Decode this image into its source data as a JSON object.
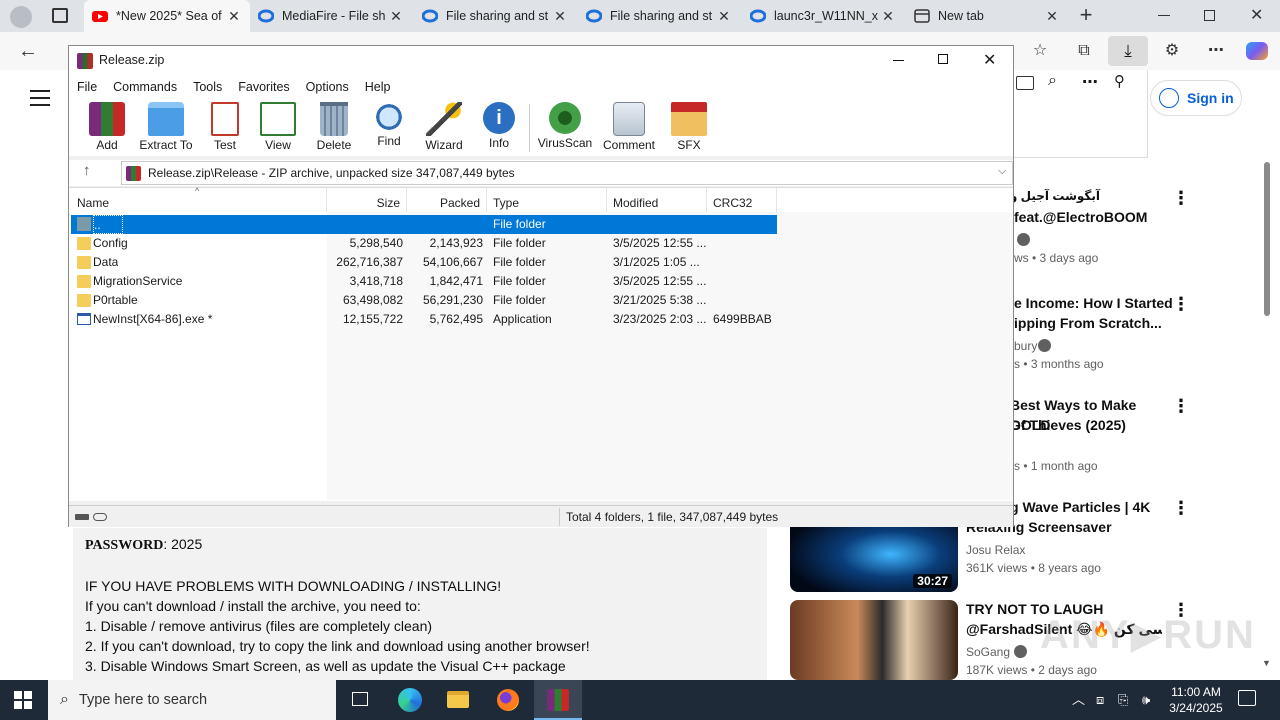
{
  "browser": {
    "tabs": [
      {
        "title": "*New 2025* Sea of",
        "icon": "youtube-icon",
        "active": true
      },
      {
        "title": "MediaFire - File sh",
        "icon": "edge-icon"
      },
      {
        "title": "File sharing and st",
        "icon": "edge-icon"
      },
      {
        "title": "File sharing and st",
        "icon": "edge-icon"
      },
      {
        "title": "launc3r_W11NN_x",
        "icon": "edge-icon"
      },
      {
        "title": "New tab",
        "icon": "newtab-icon"
      }
    ],
    "sign_in": "Sign in"
  },
  "page": {
    "description": {
      "password_label": "PASSWORD",
      "password_value": ": 2025",
      "lines": [
        "IF YOU HAVE PROBLEMS WITH DOWNLOADING / INSTALLING!",
        "If you can't download / install the archive, you need to:",
        "1. Disable / remove antivirus (files are completely clean)",
        "2. If you can't download, try to copy the link and download using another browser!",
        "3. Disable Windows Smart Screen, as well as update the Visual C++ package"
      ]
    },
    "related": [
      {
        "title1": "آبگوشت آجیل و دسر",
        "title2": "feat.@ElectroBOOM",
        "channel": "",
        "meta": "ws • 3 days ago",
        "duration": ""
      },
      {
        "title1": "e Income: How I Started",
        "title2": "ipping From Scratch...",
        "channel": "bury",
        "meta": "s • 3 months ago",
        "duration": ""
      },
      {
        "title1": "Best Ways to Make GOLD",
        "title2": "Of Thieves (2025)",
        "channel": "",
        "meta": "s • 1 month ago",
        "duration": ""
      },
      {
        "title1": "g Wave Particles | 4K",
        "title2": "Relaxing Screensaver",
        "channel": "Josu Relax",
        "meta": "361K views • 8 years ago",
        "duration": "30:27"
      },
      {
        "title1": "TRY NOT TO LAUGH",
        "title2": "@FarshadSilent 😂🔥 سی کن...",
        "channel": "SoGang",
        "meta": "187K views • 2 days ago",
        "duration": ""
      }
    ]
  },
  "winrar": {
    "title": "Release.zip",
    "menu": [
      "File",
      "Commands",
      "Tools",
      "Favorites",
      "Options",
      "Help"
    ],
    "toolbar": [
      "Add",
      "Extract To",
      "Test",
      "View",
      "Delete",
      "Find",
      "Wizard",
      "Info",
      "VirusScan",
      "Comment",
      "SFX"
    ],
    "path": "Release.zip\\Release - ZIP archive, unpacked size 347,087,449 bytes",
    "columns": [
      "Name",
      "Size",
      "Packed",
      "Type",
      "Modified",
      "CRC32"
    ],
    "rows": [
      {
        "name": "..",
        "size": "",
        "packed": "",
        "type": "File folder",
        "modified": "",
        "crc": "",
        "icon": "folder-up-icon"
      },
      {
        "name": "Config",
        "size": "5,298,540",
        "packed": "2,143,923",
        "type": "File folder",
        "modified": "3/5/2025 12:55 ...",
        "crc": "",
        "icon": "folder-icon"
      },
      {
        "name": "Data",
        "size": "262,716,387",
        "packed": "54,106,667",
        "type": "File folder",
        "modified": "3/1/2025 1:05 ...",
        "crc": "",
        "icon": "folder-icon"
      },
      {
        "name": "MigrationService",
        "size": "3,418,718",
        "packed": "1,842,471",
        "type": "File folder",
        "modified": "3/5/2025 12:55 ...",
        "crc": "",
        "icon": "folder-icon"
      },
      {
        "name": "P0rtable",
        "size": "63,498,082",
        "packed": "56,291,230",
        "type": "File folder",
        "modified": "3/21/2025 5:38 ...",
        "crc": "",
        "icon": "folder-icon"
      },
      {
        "name": "NewInst[X64-86].exe *",
        "size": "12,155,722",
        "packed": "5,762,495",
        "type": "Application",
        "modified": "3/23/2025 2:03 ...",
        "crc": "6499BBAB",
        "icon": "exe-icon"
      }
    ],
    "status": "Total 4 folders, 1 file, 347,087,449 bytes"
  },
  "taskbar": {
    "search_placeholder": "Type here to search",
    "time": "11:00 AM",
    "date": "3/24/2025"
  },
  "colors": {
    "selection": "#0078d7",
    "youtube_red": "#ff0000",
    "edge_blue": "#1e6fd9"
  }
}
